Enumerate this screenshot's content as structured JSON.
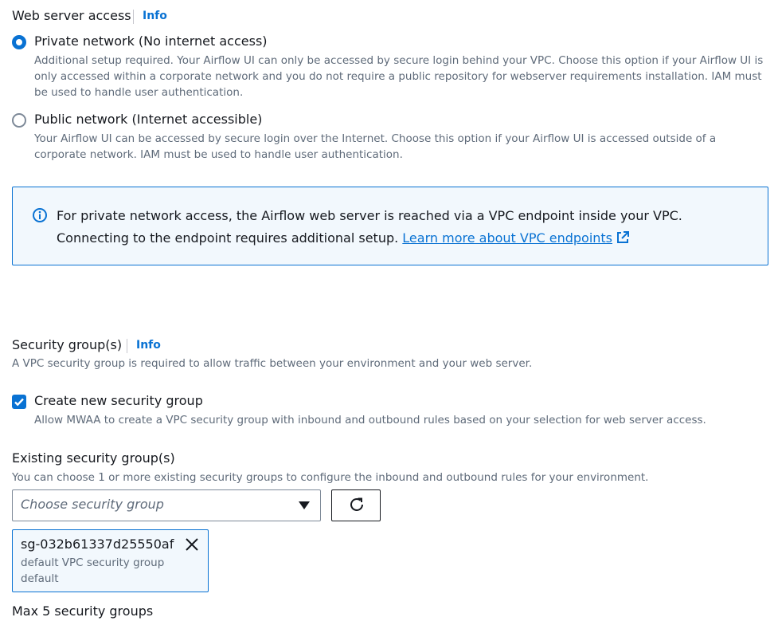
{
  "web_server_access": {
    "title": "Web server access",
    "info": "Info",
    "options": [
      {
        "label": "Private network (No internet access)",
        "description": "Additional setup required. Your Airflow UI can only be accessed by secure login behind your VPC. Choose this option if your Airflow UI is only accessed within a corporate network and you do not require a public repository for webserver requirements installation. IAM must be used to handle user authentication.",
        "selected": true
      },
      {
        "label": "Public network (Internet accessible)",
        "description": "Your Airflow UI can be accessed by secure login over the Internet. Choose this option if your Airflow UI is accessed outside of a corporate network. IAM must be used to handle user authentication.",
        "selected": false
      }
    ],
    "alert": {
      "text": "For private network access, the Airflow web server is reached via a VPC endpoint inside your VPC. Connecting to the endpoint requires additional setup.",
      "link": "Learn more about VPC endpoints",
      "icon": "info-circle-icon"
    }
  },
  "security_groups": {
    "title": "Security group(s)",
    "info": "Info",
    "description": "A VPC security group is required to allow traffic between your environment and your web server.",
    "create_new": {
      "label": "Create new security group",
      "description": "Allow MWAA to create a VPC security group with inbound and outbound rules based on your selection for web server access.",
      "checked": true
    },
    "existing": {
      "title": "Existing security group(s)",
      "description": "You can choose 1 or more existing security groups to configure the inbound and outbound rules for your environment.",
      "placeholder": "Choose security group",
      "selected": [
        {
          "id": "sg-032b61337d25550af",
          "name": "default VPC security group",
          "tag": "default"
        }
      ],
      "constraint": "Max 5 security groups"
    }
  },
  "colors": {
    "accent": "#0972d3",
    "text": "#16191f",
    "secondary_text": "#5f6b7a",
    "alert_background": "#f2f8fd"
  }
}
